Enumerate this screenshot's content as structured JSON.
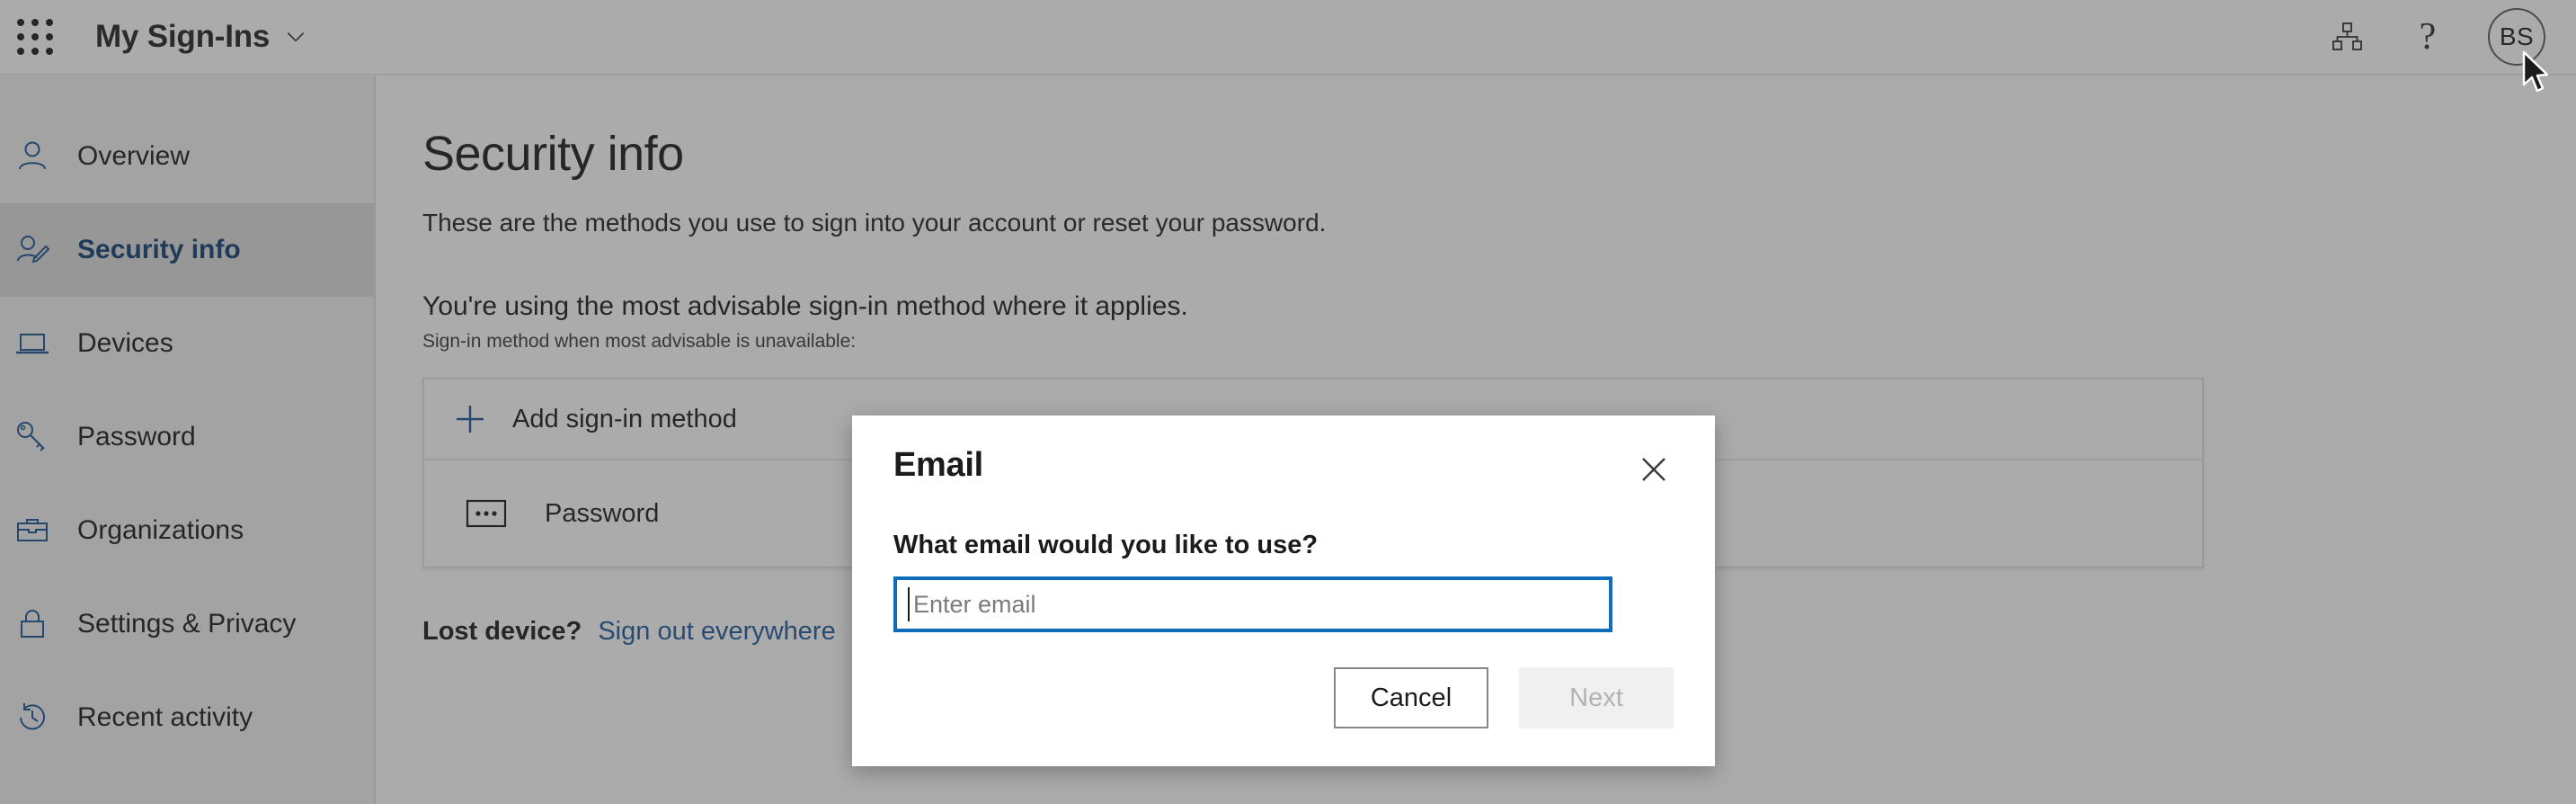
{
  "header": {
    "app_launcher_icon": "waffle-grid-icon",
    "title": "My Sign-Ins",
    "chevron_icon": "chevron-down-icon",
    "org_icon": "org-hierarchy-icon",
    "help_icon": "question-mark-icon",
    "help_glyph": "?",
    "avatar_initials": "BS"
  },
  "sidebar": {
    "items": [
      {
        "label": "Overview",
        "icon": "person-icon",
        "selected": false
      },
      {
        "label": "Security info",
        "icon": "person-edit-icon",
        "selected": true
      },
      {
        "label": "Devices",
        "icon": "laptop-icon",
        "selected": false
      },
      {
        "label": "Password",
        "icon": "key-icon",
        "selected": false
      },
      {
        "label": "Organizations",
        "icon": "briefcase-icon",
        "selected": false
      },
      {
        "label": "Settings & Privacy",
        "icon": "lock-icon",
        "selected": false
      },
      {
        "label": "Recent activity",
        "icon": "clock-history-icon",
        "selected": false
      }
    ]
  },
  "main": {
    "title": "Security info",
    "subtitle": "These are the methods you use to sign into your account or reset your password.",
    "advisable_line": "You're using the most advisable sign-in method where it applies.",
    "advisable_note": "Sign-in method when most advisable is unavailable:",
    "add_method_label": "Add sign-in method",
    "add_method_icon": "plus-icon",
    "methods": [
      {
        "label": "Password",
        "icon": "password-dots-icon"
      }
    ],
    "lost_device_label": "Lost device?",
    "sign_out_link": "Sign out everywhere"
  },
  "dialog": {
    "title": "Email",
    "close_icon": "close-icon",
    "question": "What email would you like to use?",
    "email_value": "",
    "email_placeholder": "Enter email",
    "cancel_label": "Cancel",
    "next_label": "Next",
    "next_disabled": true
  },
  "cursor": {
    "icon": "mouse-pointer-icon"
  },
  "colors": {
    "accent_blue": "#0f6cbd",
    "link_blue": "#225b9c",
    "selected_text": "#0f3f72",
    "icon_blue": "#1a5493",
    "sidebar_bg": "#f2f2f2",
    "selected_bg": "#dcdcdc",
    "overlay": "rgba(55,55,55,0.42)",
    "disabled_text": "#b3b3b3"
  }
}
